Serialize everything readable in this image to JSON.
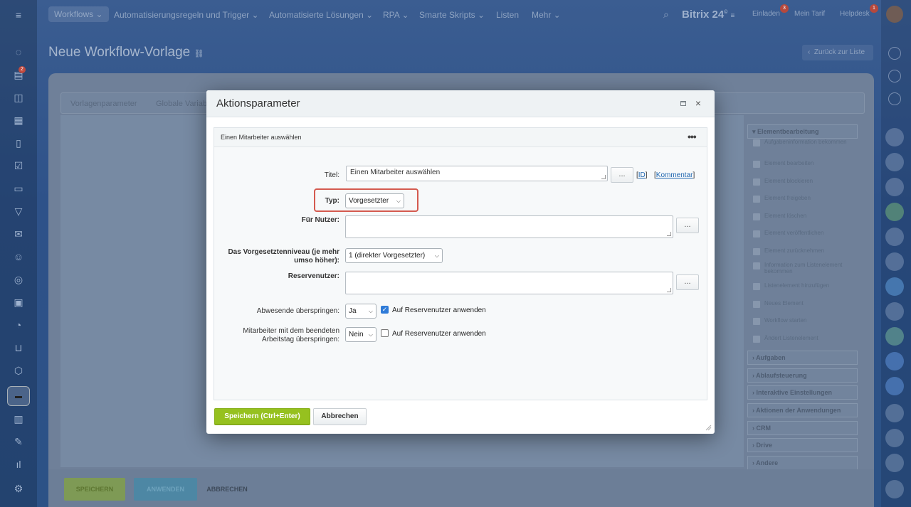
{
  "nav": {
    "items": [
      "Workflows",
      "Automatisierungsregeln und Trigger",
      "Automatisierte Lösungen",
      "RPA",
      "Smarte Skripts",
      "Listen",
      "Mehr"
    ],
    "brand": "Bitrix 24",
    "brand_sup": "©",
    "right": [
      "Einladen",
      "Mein Tarif",
      "Helpdesk"
    ],
    "badge_invite": "3",
    "badge_help": "1"
  },
  "page": {
    "title": "Neue Workflow-Vorlage",
    "back_label": "Zurück zur Liste"
  },
  "tabs": [
    "Vorlagenparameter",
    "Globale Variab"
  ],
  "palette": {
    "group_open": "Elementbearbeitung",
    "items": [
      "Aufgabeninformation bekommen",
      "Element bearbeiten",
      "Element blockieren",
      "Element freigeben",
      "Element löschen",
      "Element veröffentlichen",
      "Element zurücknehmen",
      "Information zum Listenelement bekommen",
      "Listenelement hinzufügen",
      "Neues Element",
      "Workflow starten",
      "Ändert Listenelement"
    ],
    "groups": [
      "Aufgaben",
      "Ablaufsteuerung",
      "Interaktive Einstellungen",
      "Aktionen der Anwendungen",
      "CRM",
      "Drive",
      "Andere"
    ]
  },
  "footer": {
    "save": "SPEICHERN",
    "apply": "ANWENDEN",
    "cancel": "ABBRECHEN"
  },
  "dialog": {
    "title": "Aktionsparameter",
    "section_title": "Einen Mitarbeiter auswählen",
    "fields": {
      "title_label": "Titel:",
      "title_value": "Einen Mitarbeiter auswählen",
      "id_link": "ID",
      "comment_link": "Kommentar",
      "type_label": "Typ:",
      "type_value": "Vorgesetzter",
      "for_user_label": "Für Nutzer:",
      "level_label_1": "Das Vorgesetztenniveau (je mehr",
      "level_label_2": "umso höher):",
      "level_value": "1 (direkter Vorgesetzter)",
      "reserve_label": "Reservenutzer:",
      "skip_absent_label": "Abwesende überspringen:",
      "skip_absent_value": "Ja",
      "apply_reserve_1": "Auf Reservenutzer anwenden",
      "apply_reserve_1_checked": true,
      "skip_ended_label_1": "Mitarbeiter mit dem beendeten",
      "skip_ended_label_2": "Arbeitstag überspringen:",
      "skip_ended_value": "Nein",
      "apply_reserve_2": "Auf Reservenutzer anwenden",
      "apply_reserve_2_checked": false,
      "dots": "..."
    },
    "save_button": "Speichern (Ctrl+Enter)",
    "cancel_button": "Abbrechen"
  },
  "colors": {
    "accent_green": "#96c11f",
    "highlight_red": "#d45a4f",
    "link_blue": "#2067b0"
  }
}
